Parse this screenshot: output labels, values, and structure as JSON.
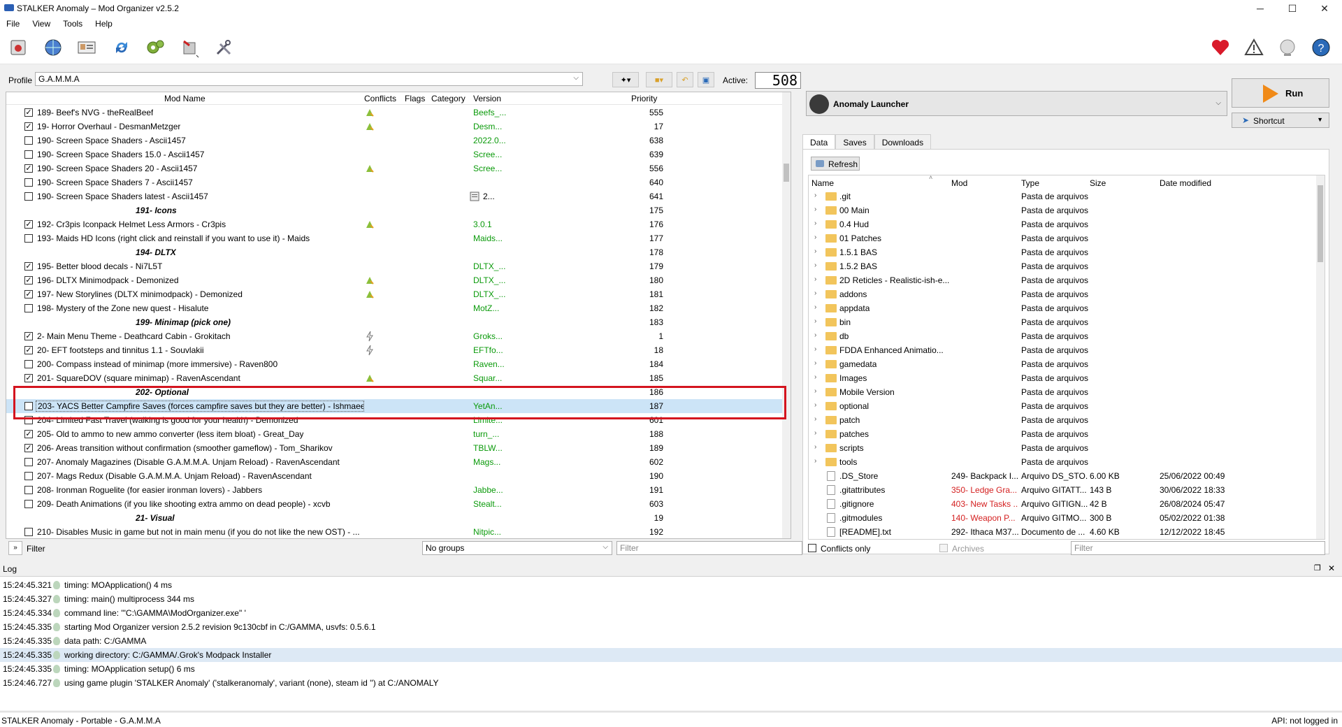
{
  "window": {
    "title": "STALKER Anomaly – Mod Organizer v2.5.2",
    "min": "─",
    "max": "☐",
    "close": "✕"
  },
  "menu": [
    "File",
    "View",
    "Tools",
    "Help"
  ],
  "profile": {
    "label": "Profile",
    "value": "G.A.M.M.A"
  },
  "active": {
    "label": "Active:",
    "count": "508"
  },
  "modlist": {
    "columns": {
      "name": "Mod Name",
      "conflicts": "Conflicts",
      "flags": "Flags",
      "category": "Category",
      "version": "Version",
      "priority": "Priority"
    },
    "rows": [
      {
        "checked": true,
        "name": "189- Beef's NVG - theRealBeef",
        "flag": "conflict",
        "version": "Beefs_...",
        "priority": "555"
      },
      {
        "checked": true,
        "name": "19- Horror Overhaul - DesmanMetzger",
        "flag": "conflict",
        "version": "Desm...",
        "priority": "17"
      },
      {
        "checked": false,
        "name": "190- Screen Space Shaders - Ascii1457",
        "flag": "",
        "version": "2022.0...",
        "priority": "638"
      },
      {
        "checked": false,
        "name": "190- Screen Space Shaders 15.0 - Ascii1457",
        "flag": "",
        "version": "Scree...",
        "priority": "639"
      },
      {
        "checked": true,
        "name": "190- Screen Space Shaders 20 - Ascii1457",
        "flag": "conflict",
        "version": "Scree...",
        "priority": "556"
      },
      {
        "checked": false,
        "name": "190- Screen Space Shaders 7 - Ascii1457",
        "flag": "",
        "version": "",
        "priority": "640"
      },
      {
        "checked": false,
        "name": "190- Screen Space Shaders latest - Ascii1457",
        "flag": "note",
        "version": "2...",
        "priority": "641"
      },
      {
        "separator": true,
        "name": "191- Icons",
        "priority": "175"
      },
      {
        "checked": true,
        "name": "192- Cr3pis Iconpack Helmet Less Armors - Cr3pis",
        "flag": "conflict",
        "version": "3.0.1",
        "priority": "176"
      },
      {
        "checked": false,
        "name": "193- Maids HD Icons (right click and reinstall if you want to use it) - Maids",
        "flag": "",
        "version": "Maids...",
        "priority": "177"
      },
      {
        "separator": true,
        "name": "194- DLTX",
        "priority": "178"
      },
      {
        "checked": true,
        "name": "195- Better blood decals - Ni7L5T",
        "flag": "",
        "version": "DLTX_...",
        "priority": "179"
      },
      {
        "checked": true,
        "name": "196- DLTX Minimodpack - Demonized",
        "flag": "conflict",
        "version": "DLTX_...",
        "priority": "180"
      },
      {
        "checked": true,
        "name": "197- New Storylines (DLTX minimodpack) - Demonized",
        "flag": "conflict",
        "version": "DLTX_...",
        "priority": "181"
      },
      {
        "checked": false,
        "name": "198- Mystery of the Zone new quest - Hisalute",
        "flag": "",
        "version": "MotZ...",
        "priority": "182"
      },
      {
        "separator": true,
        "name": "199- Minimap (pick one)",
        "priority": "183"
      },
      {
        "checked": true,
        "name": "2- Main Menu Theme - Deathcard Cabin - Grokitach",
        "flag": "bolt",
        "version": "Groks...",
        "priority": "1"
      },
      {
        "checked": true,
        "name": "20- EFT footsteps and tinnitus 1.1 - Souvlakii",
        "flag": "bolt",
        "version": "EFTfo...",
        "priority": "18"
      },
      {
        "checked": false,
        "name": "200- Compass instead of minimap (more immersive) - Raven800",
        "flag": "",
        "version": "Raven...",
        "priority": "184"
      },
      {
        "checked": true,
        "name": "201- SquareDOV (square minimap) - RavenAscendant",
        "flag": "conflict",
        "version": "Squar...",
        "priority": "185"
      },
      {
        "separator": true,
        "name": "202- Optional",
        "priority": "186"
      },
      {
        "checked": false,
        "selected": true,
        "name": "203- YACS Better Campfire Saves (forces campfire saves but they are better) - Ishmaeel",
        "flag": "",
        "version": "YetAn...",
        "priority": "187"
      },
      {
        "checked": false,
        "name": "204- Limited Fast Travel (walking is good for your health) - Demonized",
        "flag": "",
        "version": "Limite...",
        "priority": "601"
      },
      {
        "checked": true,
        "name": "205- Old to ammo to new ammo converter (less item bloat) - Great_Day",
        "flag": "",
        "version": "turn_...",
        "priority": "188"
      },
      {
        "checked": true,
        "name": "206- Areas transition without confirmation (smoother gameflow) - Tom_Sharikov",
        "flag": "",
        "version": "TBLW...",
        "priority": "189"
      },
      {
        "checked": false,
        "name": "207- Anomaly Magazines (Disable G.A.M.M.A. Unjam Reload) - RavenAscendant",
        "flag": "",
        "version": "Mags...",
        "priority": "602"
      },
      {
        "checked": false,
        "name": "207- Mags Redux (Disable G.A.M.M.A. Unjam Reload) - RavenAscendant",
        "flag": "",
        "version": "",
        "priority": "190"
      },
      {
        "checked": false,
        "name": "208- Ironman Roguelite (for easier ironman lovers) - Jabbers",
        "flag": "",
        "version": "Jabbe...",
        "priority": "191"
      },
      {
        "checked": false,
        "name": "209- Death Animations (if you like shooting extra ammo on dead people) - xcvb",
        "flag": "",
        "version": "Stealt...",
        "priority": "603"
      },
      {
        "separator": true,
        "name": "21- Visual",
        "priority": "19"
      },
      {
        "checked": false,
        "name": "210- Disables Music in game but not in main menu (if you do not like the new OST) - ...",
        "flag": "",
        "version": "Nitpic...",
        "priority": "192"
      }
    ]
  },
  "filterbar": {
    "expand": "»",
    "label": "Filter",
    "groups": "No groups",
    "filter_placeholder": "Filter"
  },
  "launcher": {
    "name": "Anomaly Launcher",
    "run": "Run",
    "shortcut": "Shortcut"
  },
  "tabs": [
    "Data",
    "Saves",
    "Downloads"
  ],
  "data": {
    "refresh": "Refresh",
    "columns": {
      "name": "Name",
      "mod": "Mod",
      "type": "Type",
      "size": "Size",
      "date": "Date modified"
    },
    "rows": [
      {
        "name": ".git",
        "mod": "",
        "type": "Pasta de arquivos",
        "size": "",
        "date": "",
        "folder": true
      },
      {
        "name": "00 Main",
        "mod": "",
        "type": "Pasta de arquivos",
        "size": "",
        "date": "",
        "folder": true
      },
      {
        "name": "0.4 Hud",
        "mod": "",
        "type": "Pasta de arquivos",
        "size": "",
        "date": "",
        "folder": true
      },
      {
        "name": "01 Patches",
        "mod": "",
        "type": "Pasta de arquivos",
        "size": "",
        "date": "",
        "folder": true
      },
      {
        "name": "1.5.1 BAS",
        "mod": "",
        "type": "Pasta de arquivos",
        "size": "",
        "date": "",
        "folder": true
      },
      {
        "name": "1.5.2 BAS",
        "mod": "",
        "type": "Pasta de arquivos",
        "size": "",
        "date": "",
        "folder": true
      },
      {
        "name": "2D Reticles - Realistic-ish-e...",
        "mod": "",
        "type": "Pasta de arquivos",
        "size": "",
        "date": "",
        "folder": true
      },
      {
        "name": "addons",
        "mod": "",
        "type": "Pasta de arquivos",
        "size": "",
        "date": "",
        "folder": true
      },
      {
        "name": "appdata",
        "mod": "",
        "type": "Pasta de arquivos",
        "size": "",
        "date": "",
        "folder": true
      },
      {
        "name": "bin",
        "mod": "",
        "type": "Pasta de arquivos",
        "size": "",
        "date": "",
        "folder": true
      },
      {
        "name": "db",
        "mod": "",
        "type": "Pasta de arquivos",
        "size": "",
        "date": "",
        "folder": true
      },
      {
        "name": "FDDA Enhanced Animatio...",
        "mod": "",
        "type": "Pasta de arquivos",
        "size": "",
        "date": "",
        "folder": true
      },
      {
        "name": "gamedata",
        "mod": "",
        "type": "Pasta de arquivos",
        "size": "",
        "date": "",
        "folder": true
      },
      {
        "name": "Images",
        "mod": "",
        "type": "Pasta de arquivos",
        "size": "",
        "date": "",
        "folder": true
      },
      {
        "name": "Mobile Version",
        "mod": "",
        "type": "Pasta de arquivos",
        "size": "",
        "date": "",
        "folder": true
      },
      {
        "name": "optional",
        "mod": "",
        "type": "Pasta de arquivos",
        "size": "",
        "date": "",
        "folder": true
      },
      {
        "name": "patch",
        "mod": "",
        "type": "Pasta de arquivos",
        "size": "",
        "date": "",
        "folder": true
      },
      {
        "name": "patches",
        "mod": "",
        "type": "Pasta de arquivos",
        "size": "",
        "date": "",
        "folder": true
      },
      {
        "name": "scripts",
        "mod": "",
        "type": "Pasta de arquivos",
        "size": "",
        "date": "",
        "folder": true
      },
      {
        "name": "tools",
        "mod": "",
        "type": "Pasta de arquivos",
        "size": "",
        "date": "",
        "folder": true
      },
      {
        "name": ".DS_Store",
        "mod": "249- Backpack I...",
        "type": "Arquivo DS_STO...",
        "size": "6.00 KB",
        "date": "25/06/2022 00:49",
        "folder": false,
        "modred": false
      },
      {
        "name": ".gitattributes",
        "mod": "350- Ledge Gra...",
        "type": "Arquivo GITATT...",
        "size": "143 B",
        "date": "30/06/2022 18:33",
        "folder": false,
        "modred": true
      },
      {
        "name": ".gitignore",
        "mod": "403- New Tasks ...",
        "type": "Arquivo GITIGN...",
        "size": "42 B",
        "date": "26/08/2024 05:47",
        "folder": false,
        "modred": true
      },
      {
        "name": ".gitmodules",
        "mod": "140- Weapon P...",
        "type": "Arquivo GITMO...",
        "size": "300 B",
        "date": "05/02/2022 01:38",
        "folder": false,
        "modred": true
      },
      {
        "name": "[README].txt",
        "mod": "292- Ithaca M37...",
        "type": "Documento de ...",
        "size": "4.60 KB",
        "date": "12/12/2022 18:45",
        "folder": false,
        "modred": false
      }
    ],
    "conflicts_only": "Conflicts only",
    "archives": "Archives",
    "filter_placeholder": "Filter"
  },
  "log": {
    "title": "Log",
    "entries": [
      {
        "time": "15:24:45.321",
        "msg": "timing: MOApplication() 4 ms"
      },
      {
        "time": "15:24:45.327",
        "msg": "timing: main() multiprocess 344 ms"
      },
      {
        "time": "15:24:45.334",
        "msg": "command line: '\"C:\\GAMMA\\ModOrganizer.exe\" '"
      },
      {
        "time": "15:24:45.335",
        "msg": "starting Mod Organizer version 2.5.2 revision 9c130cbf in C:/GAMMA, usvfs: 0.5.6.1"
      },
      {
        "time": "15:24:45.335",
        "msg": "data path: C:/GAMMA"
      },
      {
        "time": "15:24:45.335",
        "msg": "working directory: C:/GAMMA/.Grok's Modpack Installer"
      },
      {
        "time": "15:24:45.335",
        "msg": "timing: MOApplication setup() 6 ms"
      },
      {
        "time": "15:24:46.727",
        "msg": "using game plugin 'STALKER Anomaly' ('stalkeranomaly', variant (none), steam id '') at C:/ANOMALY"
      }
    ]
  },
  "status": {
    "left": "STALKER Anomaly - Portable - G.A.M.M.A",
    "right": "API: not logged in"
  }
}
